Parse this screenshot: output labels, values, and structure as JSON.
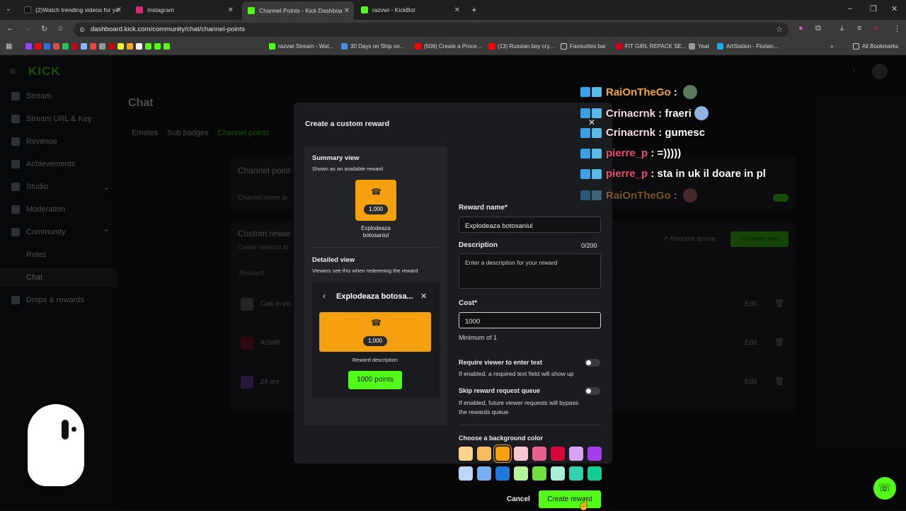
{
  "tabs": [
    {
      "label": "(2)Watch trending videos for yo",
      "color": "#111111"
    },
    {
      "label": "Instagram",
      "color": "#d62976"
    },
    {
      "label": "Channel Points - Kick Dashboa",
      "color": "#53fc18"
    },
    {
      "label": "razvwi - KickBot",
      "color": "#53fc18"
    }
  ],
  "address": {
    "url": "dashboard.kick.com/community/chat/channel-points"
  },
  "bookmarks": [
    {
      "label": "razvwi Stream - Wat...",
      "color": "#53fc18"
    },
    {
      "label": "30 Days on Ship on...",
      "color": "#4a90e2"
    },
    {
      "label": "(506) Create a Proce...",
      "color": "#ff0000"
    },
    {
      "label": "(13) Russian boy cry...",
      "color": "#ff0000"
    },
    {
      "label": "Favourites bar",
      "color": "#cccccc"
    },
    {
      "label": "FIT GIRL REPACK SE...",
      "color": "#d0021b"
    },
    {
      "label": "Yeat",
      "color": "#999999"
    },
    {
      "label": "ArtStation - Florian...",
      "color": "#13aff0"
    },
    {
      "label": "All Bookmarks",
      "color": "#cccccc"
    }
  ],
  "brand": {
    "logo": "KICK",
    "accent": "#53fc18"
  },
  "sidebar": {
    "items": [
      {
        "label": "Stream",
        "icon": "broadcast-icon"
      },
      {
        "label": "Stream URL & Key",
        "icon": "key-icon"
      },
      {
        "label": "Revenue",
        "icon": "chart-icon"
      },
      {
        "label": "Achievements",
        "icon": "trophy-icon"
      },
      {
        "label": "Studio",
        "icon": "studio-icon"
      },
      {
        "label": "Moderation",
        "icon": "wrench-icon"
      },
      {
        "label": "Community",
        "icon": "users-icon"
      },
      {
        "label": "Roles",
        "icon": ""
      },
      {
        "label": "Chat",
        "icon": ""
      },
      {
        "label": "Drops & rewards",
        "icon": "gift-icon"
      }
    ]
  },
  "main": {
    "title": "Chat",
    "tabs": [
      "Emotes",
      "Sub badges",
      "Channel points"
    ],
    "section1_title": "Channel point",
    "section1_desc": "Channel points ar",
    "section2_title": "Custom rewar",
    "section2_desc": "Create rewards to",
    "col_reward": "Reward",
    "request_queue": "Request queue",
    "create_new": "Create new",
    "rows": [
      {
        "name": "Calc in pic",
        "edit": "Edit"
      },
      {
        "name": "ASMR",
        "edit": "Edit"
      },
      {
        "name": "24 ore",
        "edit": "Edit"
      }
    ]
  },
  "modal": {
    "title": "Create a custom reward",
    "summary_title": "Summary view",
    "summary_sub": "Shown as an available reward",
    "reward_cost_badge": "1,000",
    "reward_name_line1": "Explodeaza",
    "reward_name_line2": "botosaniul",
    "detailed_title": "Detailed view",
    "detailed_sub": "Viewers see this when redeeming the reward",
    "detailed_header": "Explodeaza botosa...",
    "reward_description_label": "Reward description",
    "points_button": "1000 points",
    "reward_name_label": "Reward name*",
    "reward_name_value": "Explodeaza botosaniul",
    "description_label": "Description",
    "description_counter": "0/200",
    "description_placeholder": "Enter a description for your reward",
    "cost_label": "Cost*",
    "cost_value": "1000",
    "cost_hint": "Minimum of 1",
    "require_text_label": "Require viewer to enter text",
    "require_text_hint": "If enabled, a required text field will show up",
    "skip_queue_label": "Skip reward request queue",
    "skip_queue_hint_1": "If enabled, future viewer requests will bypass",
    "skip_queue_hint_2": "the rewards queue",
    "bg_color_label": "Choose a background color",
    "colors_row1": [
      "#fcd38d",
      "#f9bb5c",
      "#f5a00f",
      "#f7c6d0",
      "#e8618c",
      "#d6083a",
      "#d9a4f5",
      "#a43ef0"
    ],
    "colors_row2": [
      "#bcd7fb",
      "#7aaef2",
      "#1f78db",
      "#b5f59b",
      "#6ee040",
      "#a6f0da",
      "#34d1b0",
      "#14cf95"
    ],
    "selected_color": "#f5a00f",
    "cancel": "Cancel",
    "create": "Create reward"
  },
  "chat_overlay": [
    {
      "user": "RaiOnTheGo",
      "msg": "",
      "user_color": "#f5a93c"
    },
    {
      "user": "Crinacrnk",
      "msg": "fraeri",
      "user_color": "#f7d8e4"
    },
    {
      "user": "Crinacrnk",
      "msg": "gumesc",
      "user_color": "#f7d8e4"
    },
    {
      "user": "pierre_p",
      "msg": "=)))))",
      "user_color": "#e8507a"
    },
    {
      "user": "pierre_p",
      "msg": "sta in uk il doare in pl",
      "user_color": "#e8507a"
    },
    {
      "user": "RaiOnTheGo",
      "msg": "",
      "user_color": "#f5a93c"
    }
  ]
}
